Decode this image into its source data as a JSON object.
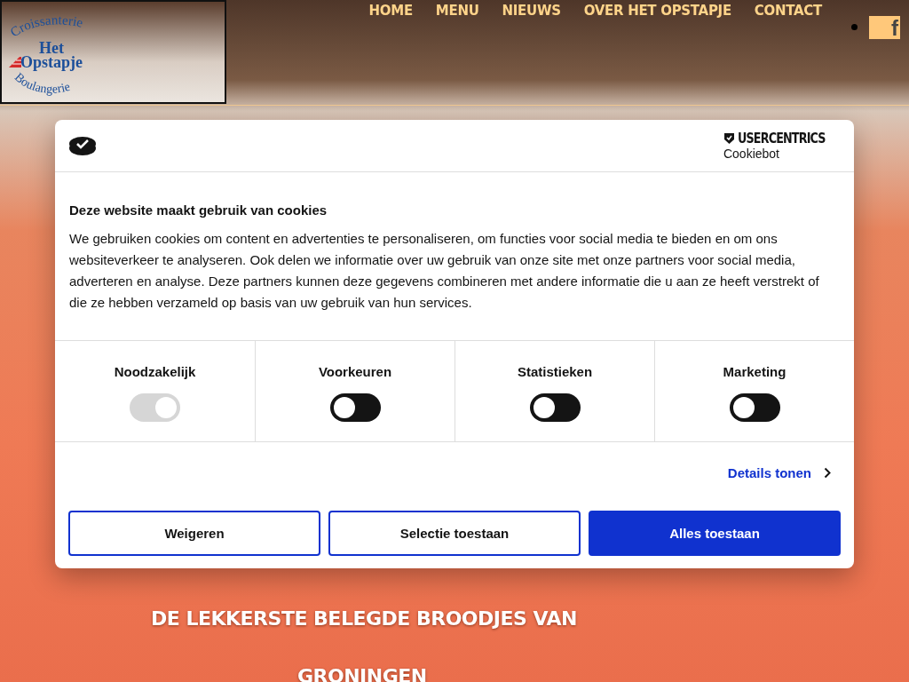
{
  "logo": {
    "top_arc": "Croissanterie",
    "line_1": "Het",
    "line_2": "Opstapje",
    "bottom_arc": "Boulangerie"
  },
  "nav": {
    "items": [
      {
        "label": "HOME"
      },
      {
        "label": "MENU"
      },
      {
        "label": "NIEUWS"
      },
      {
        "label": "OVER HET OPSTAPJE"
      },
      {
        "label": "CONTACT"
      }
    ],
    "social": "f"
  },
  "cookie_dialog": {
    "brand": "USERCENTRICS",
    "brand_sub": "Cookiebot",
    "title": "Deze website maakt gebruik van cookies",
    "body": "We gebruiken cookies om content en advertenties te personaliseren, om functies voor social media te bieden en om ons websiteverkeer te analyseren. Ook delen we informatie over uw gebruik van onze site met onze partners voor social media, adverteren en analyse. Deze partners kunnen deze gegevens combineren met andere informatie die u aan ze heeft verstrekt of die ze hebben verzameld op basis van uw gebruik van hun services.",
    "categories": [
      {
        "label": "Noodzakelijk",
        "on": true,
        "disabled": true
      },
      {
        "label": "Voorkeuren",
        "on": false,
        "disabled": false
      },
      {
        "label": "Statistieken",
        "on": false,
        "disabled": false
      },
      {
        "label": "Marketing",
        "on": false,
        "disabled": false
      }
    ],
    "details_link": "Details tonen",
    "buttons": [
      {
        "label": "Weigeren",
        "kind": "outline"
      },
      {
        "label": "Selectie toestaan",
        "kind": "outline"
      },
      {
        "label": "Alles toestaan",
        "kind": "primary"
      }
    ]
  },
  "hero": {
    "headline_1": "DE LEKKERSTE BELEGDE BROODJES VAN",
    "headline_2": "GRONINGEN"
  }
}
